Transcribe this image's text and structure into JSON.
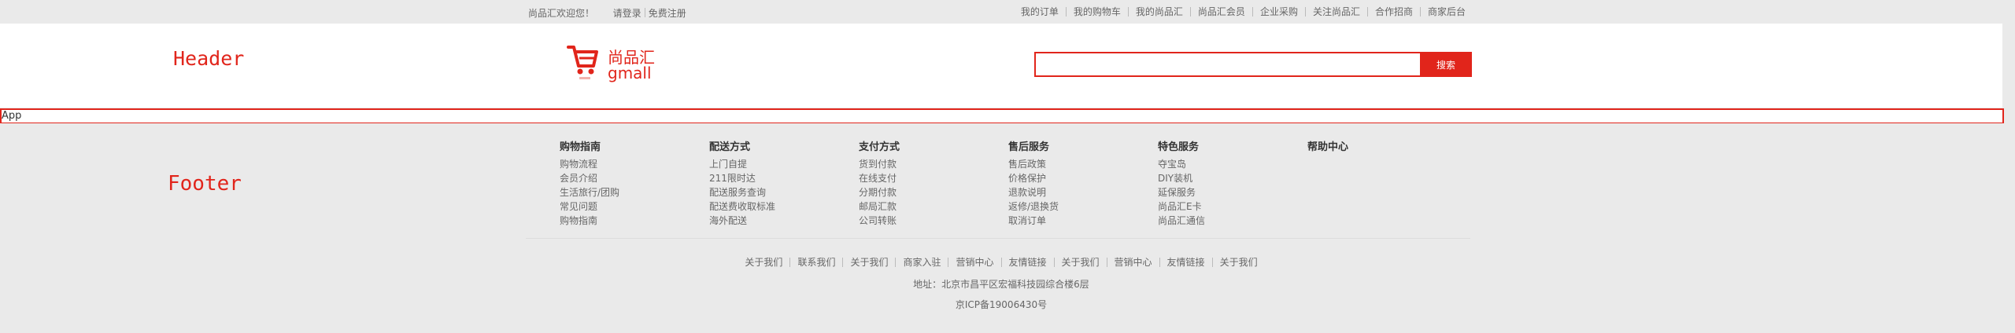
{
  "topbar": {
    "welcome": "尚品汇欢迎您！",
    "login": "请登录",
    "register": "免费注册",
    "nav": [
      "我的订单",
      "我的购物车",
      "我的尚品汇",
      "尚品汇会员",
      "企业采购",
      "关注尚品汇",
      "合作招商",
      "商家后台"
    ]
  },
  "header": {
    "tag": "Header",
    "logo": {
      "line1": "尚品汇",
      "line2": "gmall",
      "icon": "shopping-cart-icon",
      "color": "#e1251b"
    },
    "search": {
      "value": "",
      "placeholder": "",
      "button": "搜索"
    }
  },
  "app": {
    "label": "App"
  },
  "footer": {
    "tag": "Footer",
    "columns": [
      {
        "title": "购物指南",
        "items": [
          "购物流程",
          "会员介绍",
          "生活旅行/团购",
          "常见问题",
          "购物指南"
        ]
      },
      {
        "title": "配送方式",
        "items": [
          "上门自提",
          "211限时达",
          "配送服务查询",
          "配送费收取标准",
          "海外配送"
        ]
      },
      {
        "title": "支付方式",
        "items": [
          "货到付款",
          "在线支付",
          "分期付款",
          "邮局汇款",
          "公司转账"
        ]
      },
      {
        "title": "售后服务",
        "items": [
          "售后政策",
          "价格保护",
          "退款说明",
          "返修/退换货",
          "取消订单"
        ]
      },
      {
        "title": "特色服务",
        "items": [
          "夺宝岛",
          "DIY装机",
          "延保服务",
          "尚品汇E卡",
          "尚品汇通信"
        ]
      },
      {
        "title": "帮助中心",
        "items": []
      }
    ],
    "links": [
      "关于我们",
      "联系我们",
      "关于我们",
      "商家入驻",
      "营销中心",
      "友情链接",
      "关于我们",
      "营销中心",
      "友情链接",
      "关于我们"
    ],
    "address": "地址：北京市昌平区宏福科技园综合楼6层",
    "icp": "京ICP备19006430号"
  },
  "colors": {
    "accent": "#e1251b",
    "background": "#eaeaea"
  }
}
